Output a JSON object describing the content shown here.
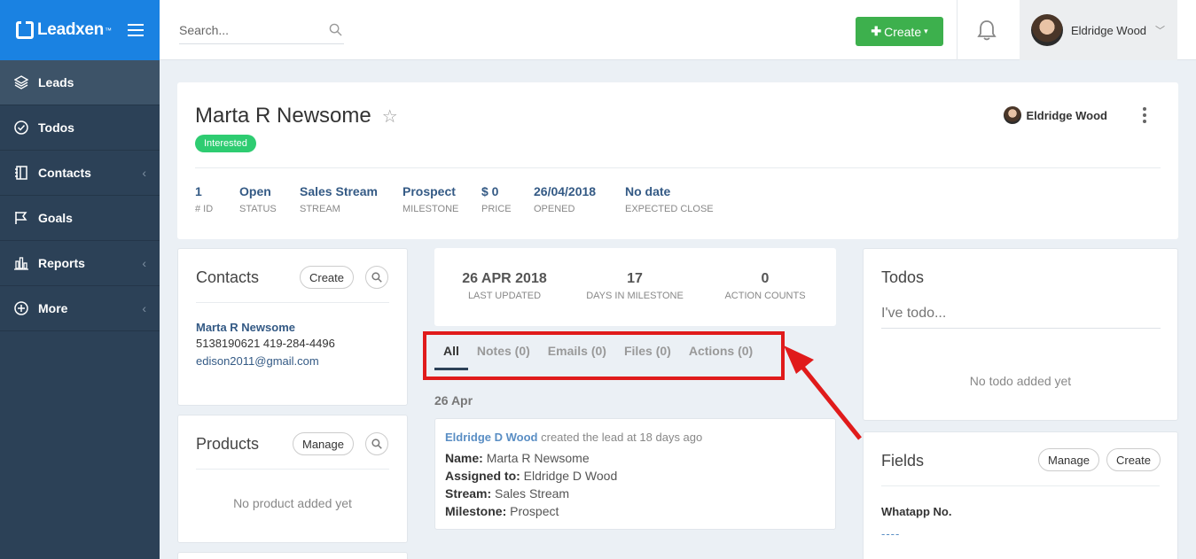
{
  "app": {
    "brand": "Leadxen",
    "brand_tm": "™"
  },
  "sidebar": {
    "items": [
      {
        "label": "Leads",
        "icon": "layers-icon",
        "active": true,
        "has_chevron": false
      },
      {
        "label": "Todos",
        "icon": "check-circle-icon",
        "active": false,
        "has_chevron": false
      },
      {
        "label": "Contacts",
        "icon": "address-book-icon",
        "active": false,
        "has_chevron": true
      },
      {
        "label": "Goals",
        "icon": "flag-icon",
        "active": false,
        "has_chevron": false
      },
      {
        "label": "Reports",
        "icon": "bar-chart-icon",
        "active": false,
        "has_chevron": true
      },
      {
        "label": "More",
        "icon": "plus-circle-icon",
        "active": false,
        "has_chevron": true
      }
    ]
  },
  "topbar": {
    "search_placeholder": "Search...",
    "create_label": "Create",
    "user_name": "Eldridge Wood"
  },
  "lead": {
    "name": "Marta R Newsome",
    "status_badge": "Interested",
    "owner": "Eldridge Wood",
    "meta": [
      {
        "value": "1",
        "key": "# ID"
      },
      {
        "value": "Open",
        "key": "STATUS"
      },
      {
        "value": "Sales Stream",
        "key": "STREAM"
      },
      {
        "value": "Prospect",
        "key": "MILESTONE"
      },
      {
        "value": "$ 0",
        "key": "PRICE"
      },
      {
        "value": "26/04/2018",
        "key": "OPENED"
      },
      {
        "value": "No date",
        "key": "EXPECTED CLOSE"
      }
    ]
  },
  "contacts": {
    "title": "Contacts",
    "create_label": "Create",
    "name": "Marta R Newsome",
    "phones": "5138190621 419-284-4496",
    "email": "edison2011@gmail.com"
  },
  "products": {
    "title": "Products",
    "manage_label": "Manage",
    "empty": "No product added yet"
  },
  "stats": [
    {
      "value": "26 APR 2018",
      "key": "LAST UPDATED"
    },
    {
      "value": "17",
      "key": "DAYS IN MILESTONE"
    },
    {
      "value": "0",
      "key": "ACTION COUNTS"
    }
  ],
  "tabs": [
    "All",
    "Notes (0)",
    "Emails (0)",
    "Files (0)",
    "Actions (0)"
  ],
  "activity": {
    "date": "26 Apr",
    "author": "Eldridge D Wood",
    "action": "created the lead at 18 days ago",
    "rows": [
      {
        "key": "Name:",
        "value": "Marta R Newsome"
      },
      {
        "key": "Assigned to:",
        "value": "Eldridge D Wood"
      },
      {
        "key": "Stream:",
        "value": "Sales Stream"
      },
      {
        "key": "Milestone:",
        "value": "Prospect"
      }
    ]
  },
  "todos": {
    "title": "Todos",
    "placeholder": "I've todo...",
    "empty": "No todo added yet"
  },
  "fields": {
    "title": "Fields",
    "manage_label": "Manage",
    "create_label": "Create",
    "field_label": "Whatapp No.",
    "field_value": "----"
  },
  "colors": {
    "brand": "#1a82e2",
    "sidebar": "#2c4157",
    "create": "#3db04d",
    "badge": "#2ecc71",
    "highlight": "#e01b1b"
  }
}
